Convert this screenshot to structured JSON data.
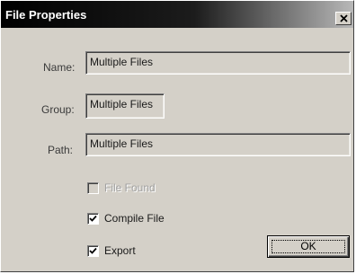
{
  "window": {
    "title": "File Properties",
    "close_glyph": "✕"
  },
  "form": {
    "name_label": "Name:",
    "name_value": "Multiple Files",
    "group_label": "Group:",
    "group_value": "Multiple Files",
    "path_label": "Path:",
    "path_value": "Multiple Files"
  },
  "options": {
    "file_found": {
      "label": "File Found",
      "checked": false,
      "enabled": false
    },
    "compile_file": {
      "label": "Compile File",
      "checked": true,
      "enabled": true
    },
    "export": {
      "label": "Export",
      "checked": true,
      "enabled": true
    }
  },
  "buttons": {
    "ok_label": "OK"
  }
}
